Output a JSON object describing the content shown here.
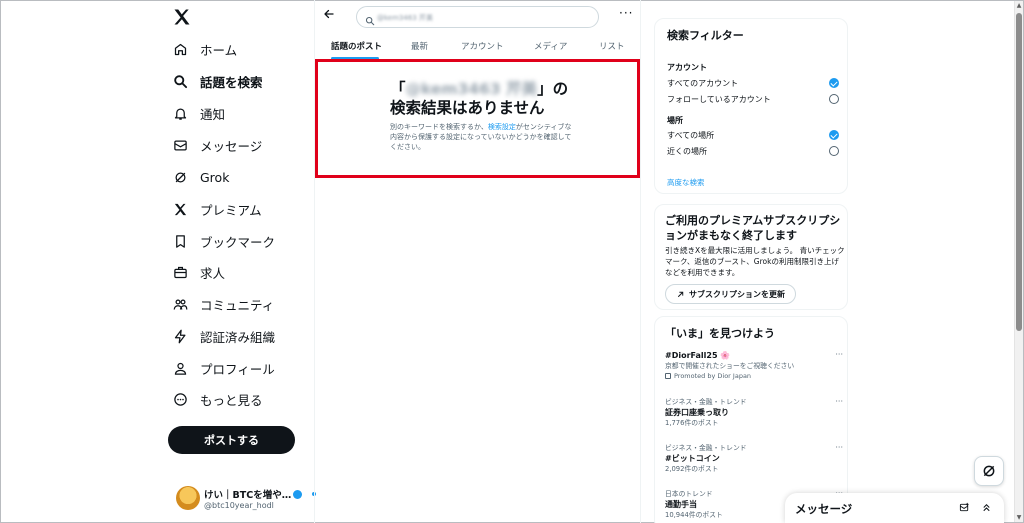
{
  "nav": {
    "items": [
      {
        "label": "ホーム",
        "icon": "home-icon"
      },
      {
        "label": "話題を検索",
        "icon": "search-icon"
      },
      {
        "label": "通知",
        "icon": "bell-icon"
      },
      {
        "label": "メッセージ",
        "icon": "mail-icon"
      },
      {
        "label": "Grok",
        "icon": "grok-icon"
      },
      {
        "label": "プレミアム",
        "icon": "x-logo-icon"
      },
      {
        "label": "ブックマーク",
        "icon": "bookmark-icon"
      },
      {
        "label": "求人",
        "icon": "briefcase-icon"
      },
      {
        "label": "コミュニティ",
        "icon": "people-icon"
      },
      {
        "label": "認証済み組織",
        "icon": "lightning-icon"
      },
      {
        "label": "プロフィール",
        "icon": "person-icon"
      },
      {
        "label": "もっと見る",
        "icon": "more-circle-icon"
      }
    ],
    "post_button": "ポストする",
    "account": {
      "name": "けい｜BTCを増や…",
      "handle": "@btc10year_hodl"
    }
  },
  "search": {
    "query": "@kem3463 芹美"
  },
  "tabs": [
    "話題のポスト",
    "最新",
    "アカウント",
    "メディア",
    "リスト"
  ],
  "empty_state": {
    "title_open": "「",
    "title_query": "@kem3463 芹美",
    "title_close": "」の",
    "title_line2": "検索結果はありません",
    "desc_before": "別のキーワードを検索するか、",
    "desc_link": "検索設定",
    "desc_after": "がセンシティブな内容から保護する設定になっていないかどうかを確認してください。"
  },
  "filters": {
    "title": "検索フィルター",
    "account_heading": "アカウント",
    "account_options": [
      {
        "label": "すべてのアカウント",
        "selected": true
      },
      {
        "label": "フォローしているアカウント",
        "selected": false
      }
    ],
    "location_heading": "場所",
    "location_options": [
      {
        "label": "すべての場所",
        "selected": true
      },
      {
        "label": "近くの場所",
        "selected": false
      }
    ],
    "advanced_link": "高度な検索"
  },
  "premium": {
    "title": "ご利用のプレミアムサブスクリプションがまもなく終了します",
    "desc": "引き続きXを最大限に活用しましょう。 青いチェックマーク、返信のブースト、Grokの利用制限引き上げなどを利用できます。",
    "button": "サブスクリプションを更新"
  },
  "trends": {
    "title": "「いま」を見つけよう",
    "items": [
      {
        "category": "",
        "name": "#DiorFall25 🌸",
        "desc": "京都で開催されたショーをご視聴ください",
        "promo": "Promoted by Dior Japan",
        "count": ""
      },
      {
        "category": "ビジネス・金融・トレンド",
        "name": "証券口座乗っ取り",
        "count": "1,776件のポスト"
      },
      {
        "category": "ビジネス・金融・トレンド",
        "name": "#ビットコイン",
        "count": "2,092件のポスト"
      },
      {
        "category": "日本のトレンド",
        "name": "通勤手当",
        "count": "10,944件のポスト"
      }
    ]
  },
  "messages_drawer": {
    "title": "メッセージ"
  },
  "colors": {
    "accent": "#1d9bf0",
    "text": "#0f1419",
    "muted": "#536471",
    "highlight_border": "#e0001a"
  }
}
